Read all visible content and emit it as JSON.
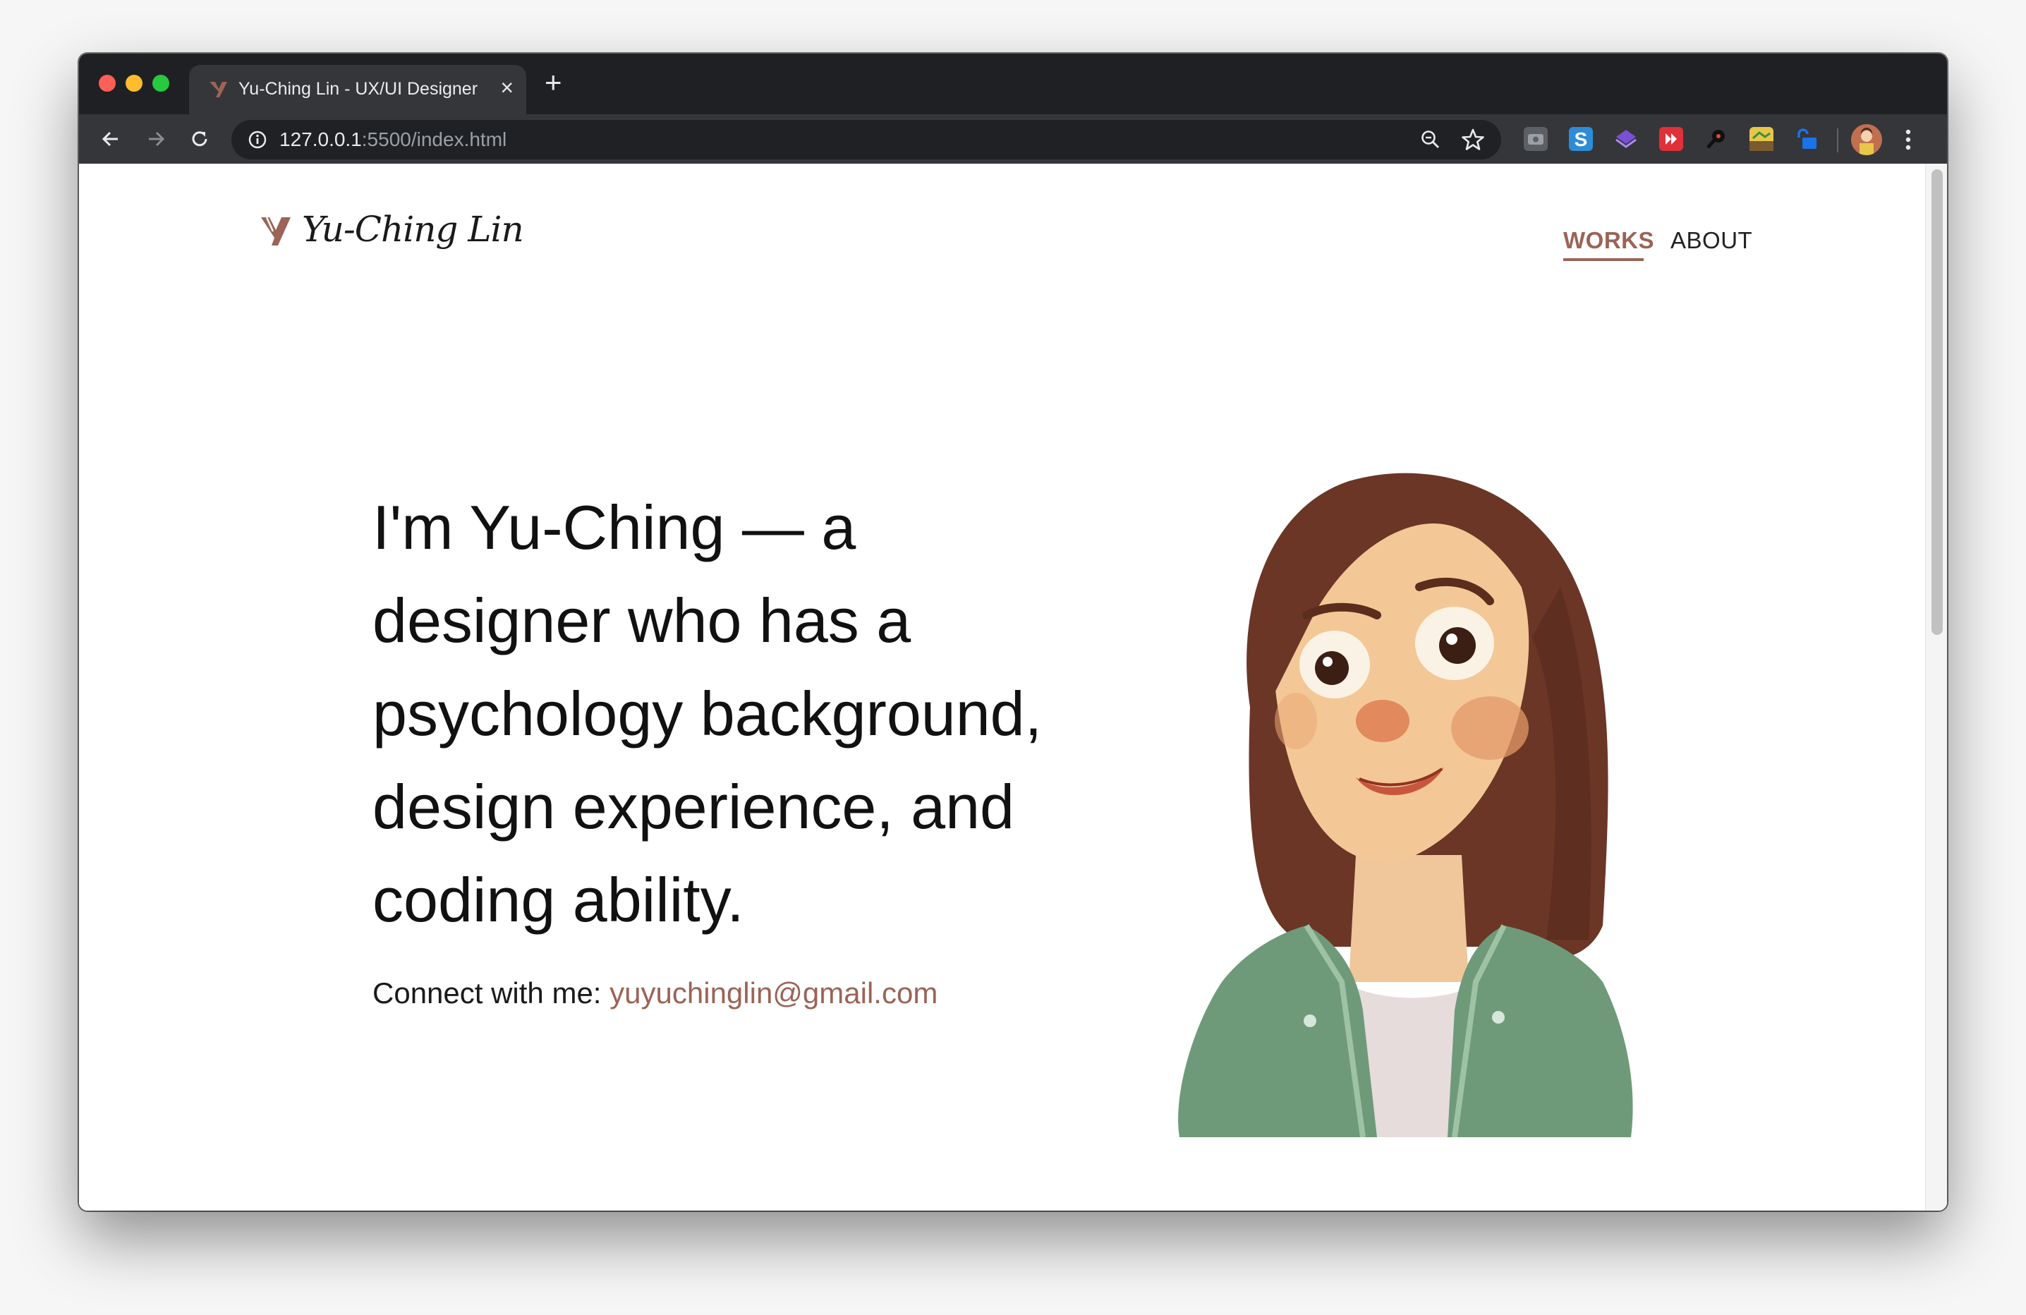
{
  "browser": {
    "tab_title": "Yu-Ching Lin - UX/UI Designer",
    "url_host": "127.0.0.1",
    "url_rest": ":5500/index.html"
  },
  "site": {
    "logo_text": "Yu-Ching Lin",
    "nav": [
      {
        "label": "WORKS",
        "active": true
      },
      {
        "label": "ABOUT",
        "active": false
      }
    ]
  },
  "hero": {
    "headline": "I'm Yu-Ching — a designer who has a psychology background, design experience, and coding ability.",
    "connect_label": "Connect with me:",
    "email": "yuyuchinglin@gmail.com"
  },
  "colors": {
    "accent": "#9b6456",
    "chrome_dark": "#1f2023",
    "chrome_toolbar": "#35363a"
  }
}
